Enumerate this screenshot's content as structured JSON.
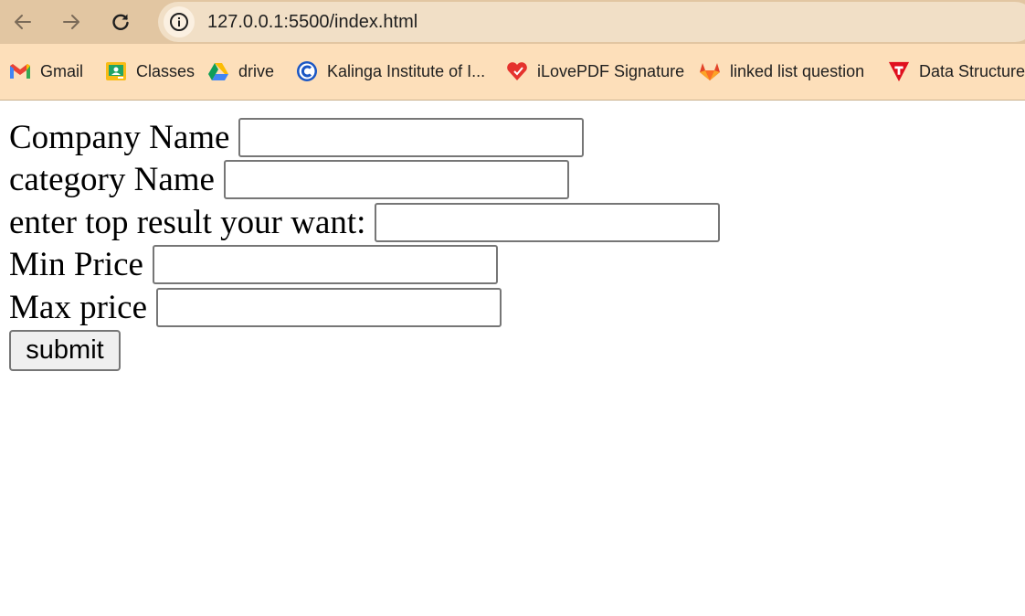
{
  "browser": {
    "url": "127.0.0.1:5500/index.html",
    "bookmarks": [
      {
        "label": "Gmail",
        "icon": "gmail-icon"
      },
      {
        "label": "Classes",
        "icon": "classroom-icon"
      },
      {
        "label": "drive",
        "icon": "drive-icon"
      },
      {
        "label": "Kalinga Institute of I...",
        "icon": "kiit-icon"
      },
      {
        "label": "iLovePDF Signature",
        "icon": "ilovepdf-icon"
      },
      {
        "label": "linked list question",
        "icon": "gitlab-icon"
      },
      {
        "label": "Data Structures",
        "icon": "data-structures-icon"
      }
    ]
  },
  "form": {
    "fields": [
      {
        "label": "Company Name",
        "value": ""
      },
      {
        "label": "category Name",
        "value": ""
      },
      {
        "label": "enter top result your want:",
        "value": ""
      },
      {
        "label": "Min Price",
        "value": ""
      },
      {
        "label": "Max price",
        "value": ""
      }
    ],
    "submit_label": "submit"
  },
  "colors": {
    "toolbar": "#e2c6a2",
    "bookmarks_bar": "#fddfba",
    "omnibox": "#f1dfc6"
  }
}
